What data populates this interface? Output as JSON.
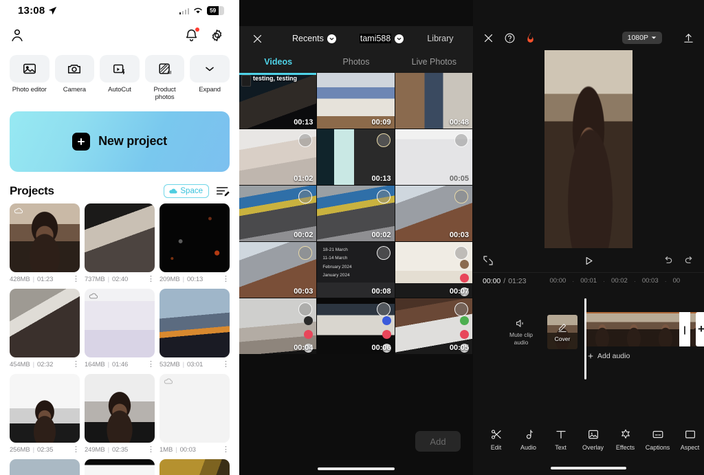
{
  "home": {
    "status": {
      "time": "13:08",
      "location_icon": "location-arrow-icon",
      "battery_level": "59"
    },
    "topbar": {
      "profile_icon": "person-icon",
      "bell_icon": "bell-icon",
      "settings_icon": "gear-icon"
    },
    "quick_actions": [
      {
        "label": "Photo editor",
        "icon": "image-edit-icon"
      },
      {
        "label": "Camera",
        "icon": "camera-icon"
      },
      {
        "label": "AutoCut",
        "icon": "autocut-icon"
      },
      {
        "label": "Product photos",
        "icon": "product-ai-icon"
      },
      {
        "label": "Expand",
        "icon": "chevron-down-icon"
      }
    ],
    "new_project": {
      "label": "New project",
      "icon": "plus-icon"
    },
    "projects_header": {
      "title": "Projects",
      "space_label": "Space",
      "space_icon": "cloud-icon",
      "sort_icon": "sort-edit-icon",
      "accent": "#38c2dc"
    },
    "projects": [
      {
        "size": "428MB",
        "duration": "01:23",
        "thumb": "t-person1",
        "cloud": true
      },
      {
        "size": "737MB",
        "duration": "02:40",
        "thumb": "t-room",
        "cloud": false
      },
      {
        "size": "209MB",
        "duration": "00:13",
        "thumb": "t-space",
        "cloud": false
      },
      {
        "size": "454MB",
        "duration": "02:32",
        "thumb": "t-plane",
        "cloud": false
      },
      {
        "size": "164MB",
        "duration": "01:46",
        "thumb": "t-canva",
        "cloud": true
      },
      {
        "size": "532MB",
        "duration": "03:01",
        "thumb": "t-wing",
        "cloud": false
      },
      {
        "size": "256MB",
        "duration": "02:35",
        "thumb": "t-notes1",
        "cloud": false
      },
      {
        "size": "249MB",
        "duration": "02:35",
        "thumb": "t-notes2",
        "cloud": false
      },
      {
        "size": "1MB",
        "duration": "00:03",
        "thumb": "t-notes3",
        "cloud": true
      }
    ],
    "partial_row": [
      {
        "thumb": "t-blue"
      },
      {
        "thumb": "t-black"
      },
      {
        "thumb": "t-gold"
      }
    ]
  },
  "picker": {
    "header": {
      "close_icon": "close-icon",
      "album_label": "Recents",
      "album_chevron_icon": "chevron-down-circle-icon",
      "account_label": "tami588",
      "account_chevron_icon": "chevron-down-circle-icon",
      "library_label": "Library"
    },
    "tabs": [
      {
        "label": "Videos",
        "active": true
      },
      {
        "label": "Photos",
        "active": false
      },
      {
        "label": "Live Photos",
        "active": false
      }
    ],
    "active_tab_color": "#4fd3e8",
    "cells": [
      {
        "duration": "00:13",
        "image": "i-car",
        "caption": "testing, testing",
        "selected_border": true,
        "circle": false,
        "badge": "tiktok-badge"
      },
      {
        "duration": "00:09",
        "image": "i-wed",
        "caption": "",
        "selected_border": false,
        "circle": false
      },
      {
        "duration": "00:48",
        "image": "i-guys",
        "caption": "",
        "selected_border": false,
        "circle": false
      },
      {
        "duration": "01:02",
        "image": "i-bed",
        "caption": "",
        "selected_border": false,
        "circle": true
      },
      {
        "duration": "00:13",
        "image": "i-chat",
        "caption": "",
        "selected_border": false,
        "circle": true,
        "circle_warm": true
      },
      {
        "duration": "00:05",
        "image": "i-phone",
        "caption": "",
        "selected_border": false,
        "circle": true
      },
      {
        "duration": "00:02",
        "image": "i-laptop",
        "caption": "",
        "selected_border": false,
        "circle": true
      },
      {
        "duration": "00:02",
        "image": "i-laptop",
        "caption": "",
        "selected_border": false,
        "circle": true
      },
      {
        "duration": "00:03",
        "image": "i-hand",
        "caption": "",
        "selected_border": false,
        "circle": true,
        "circle_warm": true
      },
      {
        "duration": "00:03",
        "image": "i-hand",
        "caption": "",
        "selected_border": false,
        "circle": true,
        "circle_warm": true
      },
      {
        "duration": "00:08",
        "image": "i-notes",
        "caption": "",
        "selected_border": false,
        "circle": true,
        "notes": [
          "18-21 March",
          "11-14 March",
          "February 2024",
          "January 2024"
        ]
      },
      {
        "duration": "00:07",
        "image": "i-glass",
        "caption": "",
        "selected_border": false,
        "circle": true
      },
      {
        "duration": "00:04",
        "image": "i-room2",
        "caption": "",
        "selected_border": false,
        "circle": true
      },
      {
        "duration": "00:06",
        "image": "i-madrid",
        "caption": "",
        "selected_border": false,
        "circle": true
      },
      {
        "duration": "00:05",
        "image": "i-dress",
        "caption": "",
        "selected_border": false,
        "circle": true
      }
    ],
    "footer": {
      "add_label": "Add",
      "add_enabled": false
    }
  },
  "editor": {
    "header": {
      "close_icon": "close-icon",
      "help_icon": "help-circle-icon",
      "flame_icon": "flame-icon",
      "resolution": "1080P",
      "resolution_chevron_icon": "chevron-down-icon",
      "export_icon": "upload-icon"
    },
    "controls": {
      "fullscreen_icon": "expand-icon",
      "play_icon": "play-icon",
      "undo_icon": "undo-icon",
      "redo_icon": "redo-icon"
    },
    "time": {
      "current": "00:00",
      "separator": "/",
      "total": "01:23"
    },
    "ruler": [
      "00:00",
      "00:01",
      "00:02",
      "00:03",
      "00"
    ],
    "timeline": {
      "mute_label": "Mute clip audio",
      "mute_icon": "speaker-mute-icon",
      "cover_label": "Cover",
      "cover_pen_icon": "pencil-icon",
      "split_handle_icon": "split-handle-icon",
      "add_clip_icon": "plus-icon",
      "add_audio_label": "Add audio",
      "add_audio_icon": "plus-icon"
    },
    "toolbar": [
      {
        "label": "Edit",
        "icon": "scissors-icon"
      },
      {
        "label": "Audio",
        "icon": "music-note-icon"
      },
      {
        "label": "Text",
        "icon": "text-t-icon"
      },
      {
        "label": "Overlay",
        "icon": "overlay-icon"
      },
      {
        "label": "Effects",
        "icon": "sparkle-icon"
      },
      {
        "label": "Captions",
        "icon": "captions-icon"
      },
      {
        "label": "Aspect",
        "icon": "aspect-ratio-icon"
      }
    ]
  }
}
